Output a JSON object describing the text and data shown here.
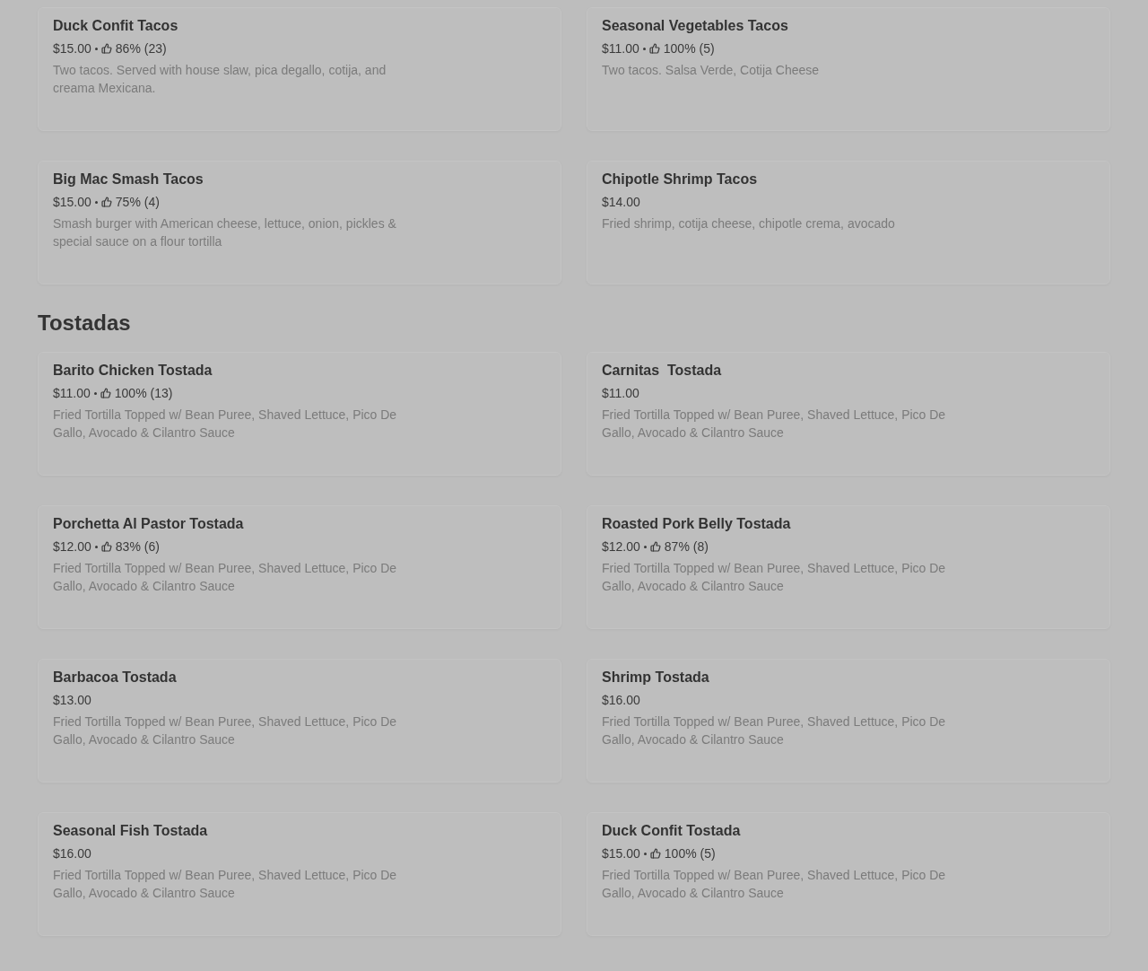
{
  "sections": [
    {
      "items": [
        {
          "name": "Duck Confit Tacos",
          "price": "$15.00",
          "rating": "86% (23)",
          "description": "Two tacos. Served with house slaw, pica degallo, cotija, and creama Mexicana."
        },
        {
          "name": "Seasonal Vegetables Tacos",
          "price": "$11.00",
          "rating": "100% (5)",
          "description": "Two tacos. Salsa Verde, Cotija Cheese"
        },
        {
          "name": "Big Mac Smash Tacos",
          "price": "$15.00",
          "rating": "75% (4)",
          "description": "Smash burger with American cheese, lettuce, onion, pickles & special sauce on a flour tortilla"
        },
        {
          "name": "Chipotle Shrimp Tacos",
          "price": "$14.00",
          "description": "Fried shrimp, cotija cheese, chipotle crema, avocado"
        }
      ]
    },
    {
      "heading": "Tostadas",
      "items": [
        {
          "name": "Barito Chicken Tostada",
          "price": "$11.00",
          "rating": "100% (13)",
          "description": "Fried Tortilla Topped w/ Bean Puree, Shaved Lettuce, Pico De Gallo, Avocado & Cilantro Sauce"
        },
        {
          "name": "Carnitas  Tostada",
          "price": "$11.00",
          "description": "Fried Tortilla Topped w/ Bean Puree, Shaved Lettuce, Pico De Gallo, Avocado & Cilantro Sauce"
        },
        {
          "name": "Porchetta Al Pastor Tostada",
          "price": "$12.00",
          "rating": "83% (6)",
          "description": "Fried Tortilla Topped w/ Bean Puree, Shaved Lettuce, Pico De Gallo, Avocado & Cilantro Sauce"
        },
        {
          "name": "Roasted Pork Belly Tostada",
          "price": "$12.00",
          "rating": "87% (8)",
          "description": "Fried Tortilla Topped w/ Bean Puree, Shaved Lettuce, Pico De Gallo, Avocado & Cilantro Sauce"
        },
        {
          "name": "Barbacoa Tostada",
          "price": "$13.00",
          "description": "Fried Tortilla Topped w/ Bean Puree, Shaved Lettuce, Pico De Gallo, Avocado & Cilantro Sauce"
        },
        {
          "name": "Shrimp Tostada",
          "price": "$16.00",
          "description": "Fried Tortilla Topped w/ Bean Puree, Shaved Lettuce, Pico De Gallo, Avocado & Cilantro Sauce"
        },
        {
          "name": "Seasonal Fish Tostada",
          "price": "$16.00",
          "description": "Fried Tortilla Topped w/ Bean Puree, Shaved Lettuce, Pico De Gallo, Avocado & Cilantro Sauce"
        },
        {
          "name": "Duck Confit Tostada",
          "price": "$15.00",
          "rating": "100% (5)",
          "description": "Fried Tortilla Topped w/ Bean Puree, Shaved Lettuce, Pico De Gallo, Avocado & Cilantro Sauce"
        }
      ]
    }
  ]
}
